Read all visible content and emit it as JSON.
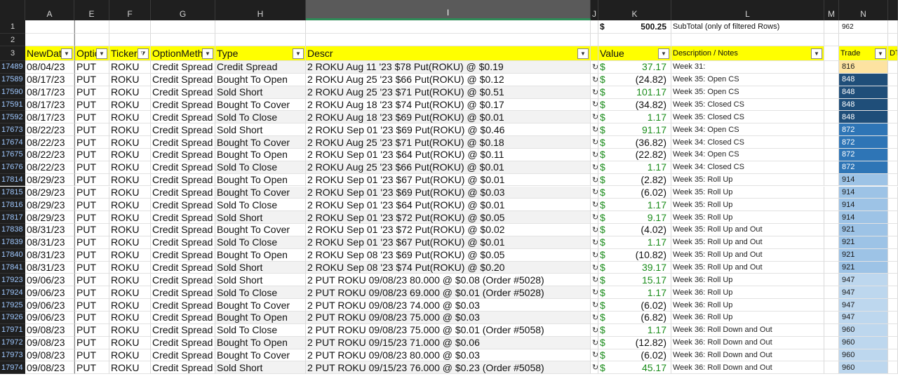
{
  "columns": [
    "",
    "A",
    "E",
    "F",
    "G",
    "H",
    "I",
    "J",
    "K",
    "L",
    "M",
    "N",
    ""
  ],
  "row1": {
    "num": "1",
    "dollar": "$",
    "total": "500.25",
    "label": "SubTotal (only of filtered Rows)",
    "n_value": "962"
  },
  "row2": {
    "num": "2"
  },
  "header": {
    "num": "3",
    "labels": [
      "NewDate",
      "Option",
      "Ticker",
      "OptionMethod",
      "Type",
      "Descr",
      "",
      "Value",
      "Description / Notes",
      "",
      "Trade",
      "DTE"
    ]
  },
  "icons": {
    "filter": "filter-dropdown-icon",
    "refresh": "refresh-icon"
  },
  "colors": {
    "header_yellow": "#ffff00",
    "positive": "#1a8c1a",
    "trade_816": "#fde3a1",
    "trade_848": "#1f4e79",
    "trade_872": "#2e75b6",
    "trade_914": "#9dc3e6",
    "trade_947": "#bdd7ee"
  },
  "rows": [
    {
      "num": "17489",
      "date": "08/04/23",
      "opt": "PUT",
      "ticker": "ROKU",
      "method": "Credit Spread",
      "type": "Credit Spread",
      "descr": "2 ROKU Aug 11 '23 $78 Put(ROKU) @ $0.19",
      "value": "37.17",
      "neg": false,
      "notes": "Week 31:",
      "trade": "816",
      "tcolor": "#fde3a1",
      "tdark": false
    },
    {
      "num": "17589",
      "date": "08/17/23",
      "opt": "PUT",
      "ticker": "ROKU",
      "method": "Credit Spread",
      "type": "Bought To Open",
      "descr": "2 ROKU Aug 25 '23 $66 Put(ROKU) @ $0.12",
      "value": "(24.82)",
      "neg": true,
      "notes": "Week 35: Open CS",
      "trade": "848",
      "tcolor": "#1f4e79",
      "tdark": true
    },
    {
      "num": "17590",
      "date": "08/17/23",
      "opt": "PUT",
      "ticker": "ROKU",
      "method": "Credit Spread",
      "type": "Sold Short",
      "descr": "2 ROKU Aug 25 '23 $71 Put(ROKU) @ $0.51",
      "value": "101.17",
      "neg": false,
      "notes": "Week 35: Open CS",
      "trade": "848",
      "tcolor": "#1f4e79",
      "tdark": true
    },
    {
      "num": "17591",
      "date": "08/17/23",
      "opt": "PUT",
      "ticker": "ROKU",
      "method": "Credit Spread",
      "type": "Bought To Cover",
      "descr": "2 ROKU Aug 18 '23 $74 Put(ROKU) @ $0.17",
      "value": "(34.82)",
      "neg": true,
      "notes": "Week 35: Closed CS",
      "trade": "848",
      "tcolor": "#1f4e79",
      "tdark": true
    },
    {
      "num": "17592",
      "date": "08/17/23",
      "opt": "PUT",
      "ticker": "ROKU",
      "method": "Credit Spread",
      "type": "Sold To Close",
      "descr": "2 ROKU Aug 18 '23 $69 Put(ROKU) @ $0.01",
      "value": "1.17",
      "neg": false,
      "notes": "Week 35: Closed CS",
      "trade": "848",
      "tcolor": "#1f4e79",
      "tdark": true
    },
    {
      "num": "17673",
      "date": "08/22/23",
      "opt": "PUT",
      "ticker": "ROKU",
      "method": "Credit Spread",
      "type": "Sold Short",
      "descr": "2 ROKU Sep 01 '23 $69 Put(ROKU) @ $0.46",
      "value": "91.17",
      "neg": false,
      "notes": "Week 34: Open CS",
      "trade": "872",
      "tcolor": "#2e75b6",
      "tdark": true
    },
    {
      "num": "17674",
      "date": "08/22/23",
      "opt": "PUT",
      "ticker": "ROKU",
      "method": "Credit Spread",
      "type": "Bought To Cover",
      "descr": "2 ROKU Aug 25 '23 $71 Put(ROKU) @ $0.18",
      "value": "(36.82)",
      "neg": true,
      "notes": "Week 34: Closed CS",
      "trade": "872",
      "tcolor": "#2e75b6",
      "tdark": true
    },
    {
      "num": "17675",
      "date": "08/22/23",
      "opt": "PUT",
      "ticker": "ROKU",
      "method": "Credit Spread",
      "type": "Bought To Open",
      "descr": "2 ROKU Sep 01 '23 $64 Put(ROKU) @ $0.11",
      "value": "(22.82)",
      "neg": true,
      "notes": "Week 34: Open CS",
      "trade": "872",
      "tcolor": "#2e75b6",
      "tdark": true
    },
    {
      "num": "17676",
      "date": "08/22/23",
      "opt": "PUT",
      "ticker": "ROKU",
      "method": "Credit Spread",
      "type": "Sold To Close",
      "descr": "2 ROKU Aug 25 '23 $66 Put(ROKU) @ $0.01",
      "value": "1.17",
      "neg": false,
      "notes": "Week 34: Closed CS",
      "trade": "872",
      "tcolor": "#2e75b6",
      "tdark": true
    },
    {
      "num": "17814",
      "date": "08/29/23",
      "opt": "PUT",
      "ticker": "ROKU",
      "method": "Credit Spread",
      "type": "Bought To Open",
      "descr": "2 ROKU Sep 01 '23 $67 Put(ROKU) @ $0.01",
      "value": "(2.82)",
      "neg": true,
      "notes": "Week 35: Roll Up",
      "trade": "914",
      "tcolor": "#9dc3e6",
      "tdark": false
    },
    {
      "num": "17815",
      "date": "08/29/23",
      "opt": "PUT",
      "ticker": "ROKU",
      "method": "Credit Spread",
      "type": "Bought To Cover",
      "descr": "2 ROKU Sep 01 '23 $69 Put(ROKU) @ $0.03",
      "value": "(6.02)",
      "neg": true,
      "notes": "Week 35: Roll Up",
      "trade": "914",
      "tcolor": "#9dc3e6",
      "tdark": false
    },
    {
      "num": "17816",
      "date": "08/29/23",
      "opt": "PUT",
      "ticker": "ROKU",
      "method": "Credit Spread",
      "type": "Sold To Close",
      "descr": "2 ROKU Sep 01 '23 $64 Put(ROKU) @ $0.01",
      "value": "1.17",
      "neg": false,
      "notes": "Week 35: Roll Up",
      "trade": "914",
      "tcolor": "#9dc3e6",
      "tdark": false
    },
    {
      "num": "17817",
      "date": "08/29/23",
      "opt": "PUT",
      "ticker": "ROKU",
      "method": "Credit Spread",
      "type": "Sold Short",
      "descr": "2 ROKU Sep 01 '23 $72 Put(ROKU) @ $0.05",
      "value": "9.17",
      "neg": false,
      "notes": "Week 35: Roll Up",
      "trade": "914",
      "tcolor": "#9dc3e6",
      "tdark": false
    },
    {
      "num": "17838",
      "date": "08/31/23",
      "opt": "PUT",
      "ticker": "ROKU",
      "method": "Credit Spread",
      "type": "Bought To Cover",
      "descr": "2 ROKU Sep 01 '23 $72 Put(ROKU) @ $0.02",
      "value": "(4.02)",
      "neg": true,
      "notes": "Week 35: Roll Up and Out",
      "trade": "921",
      "tcolor": "#9dc3e6",
      "tdark": false
    },
    {
      "num": "17839",
      "date": "08/31/23",
      "opt": "PUT",
      "ticker": "ROKU",
      "method": "Credit Spread",
      "type": "Sold To Close",
      "descr": "2 ROKU Sep 01 '23 $67 Put(ROKU) @ $0.01",
      "value": "1.17",
      "neg": false,
      "notes": "Week 35: Roll Up and Out",
      "trade": "921",
      "tcolor": "#9dc3e6",
      "tdark": false
    },
    {
      "num": "17840",
      "date": "08/31/23",
      "opt": "PUT",
      "ticker": "ROKU",
      "method": "Credit Spread",
      "type": "Bought To Open",
      "descr": "2 ROKU Sep 08 '23 $69 Put(ROKU) @ $0.05",
      "value": "(10.82)",
      "neg": true,
      "notes": "Week 35: Roll Up and Out",
      "trade": "921",
      "tcolor": "#9dc3e6",
      "tdark": false
    },
    {
      "num": "17841",
      "date": "08/31/23",
      "opt": "PUT",
      "ticker": "ROKU",
      "method": "Credit Spread",
      "type": "Sold Short",
      "descr": "2 ROKU Sep 08 '23 $74 Put(ROKU) @ $0.20",
      "value": "39.17",
      "neg": false,
      "notes": "Week 35: Roll Up and Out",
      "trade": "921",
      "tcolor": "#9dc3e6",
      "tdark": false
    },
    {
      "num": "17923",
      "date": "09/06/23",
      "opt": "PUT",
      "ticker": "ROKU",
      "method": "Credit Spread",
      "type": "Sold Short",
      "descr": "2 PUT ROKU 09/08/23 80.000 @ $0.08 (Order #5028)",
      "value": "15.17",
      "neg": false,
      "notes": "Week 36: Roll Up",
      "trade": "947",
      "tcolor": "#bdd7ee",
      "tdark": false
    },
    {
      "num": "17924",
      "date": "09/06/23",
      "opt": "PUT",
      "ticker": "ROKU",
      "method": "Credit Spread",
      "type": "Sold To Close",
      "descr": "2 PUT ROKU 09/08/23 69.000 @ $0.01 (Order #5028)",
      "value": "1.17",
      "neg": false,
      "notes": "Week 36: Roll Up",
      "trade": "947",
      "tcolor": "#bdd7ee",
      "tdark": false
    },
    {
      "num": "17925",
      "date": "09/06/23",
      "opt": "PUT",
      "ticker": "ROKU",
      "method": "Credit Spread",
      "type": "Bought To Cover",
      "descr": "2 PUT ROKU 09/08/23 74.000 @ $0.03",
      "value": "(6.02)",
      "neg": true,
      "notes": "Week 36: Roll Up",
      "trade": "947",
      "tcolor": "#bdd7ee",
      "tdark": false
    },
    {
      "num": "17926",
      "date": "09/06/23",
      "opt": "PUT",
      "ticker": "ROKU",
      "method": "Credit Spread",
      "type": "Bought To Open",
      "descr": "2 PUT ROKU 09/08/23 75.000 @ $0.03",
      "value": "(6.82)",
      "neg": true,
      "notes": "Week 36: Roll Up",
      "trade": "947",
      "tcolor": "#bdd7ee",
      "tdark": false
    },
    {
      "num": "17971",
      "date": "09/08/23",
      "opt": "PUT",
      "ticker": "ROKU",
      "method": "Credit Spread",
      "type": "Sold To Close",
      "descr": "2 PUT ROKU 09/08/23 75.000 @ $0.01 (Order #5058)",
      "value": "1.17",
      "neg": false,
      "notes": "Week 36: Roll Down and Out",
      "trade": "960",
      "tcolor": "#bdd7ee",
      "tdark": false
    },
    {
      "num": "17972",
      "date": "09/08/23",
      "opt": "PUT",
      "ticker": "ROKU",
      "method": "Credit Spread",
      "type": "Bought To Open",
      "descr": "2 PUT ROKU 09/15/23 71.000 @ $0.06",
      "value": "(12.82)",
      "neg": true,
      "notes": "Week 36: Roll Down and Out",
      "trade": "960",
      "tcolor": "#bdd7ee",
      "tdark": false
    },
    {
      "num": "17973",
      "date": "09/08/23",
      "opt": "PUT",
      "ticker": "ROKU",
      "method": "Credit Spread",
      "type": "Bought To Cover",
      "descr": "2 PUT ROKU 09/08/23 80.000 @ $0.03",
      "value": "(6.02)",
      "neg": true,
      "notes": "Week 36: Roll Down and Out",
      "trade": "960",
      "tcolor": "#bdd7ee",
      "tdark": false
    },
    {
      "num": "17974",
      "date": "09/08/23",
      "opt": "PUT",
      "ticker": "ROKU",
      "method": "Credit Spread",
      "type": "Sold Short",
      "descr": "2 PUT ROKU 09/15/23 76.000 @ $0.23 (Order #5058)",
      "value": "45.17",
      "neg": false,
      "notes": "Week 36: Roll Down and Out",
      "trade": "960",
      "tcolor": "#bdd7ee",
      "tdark": false
    }
  ]
}
